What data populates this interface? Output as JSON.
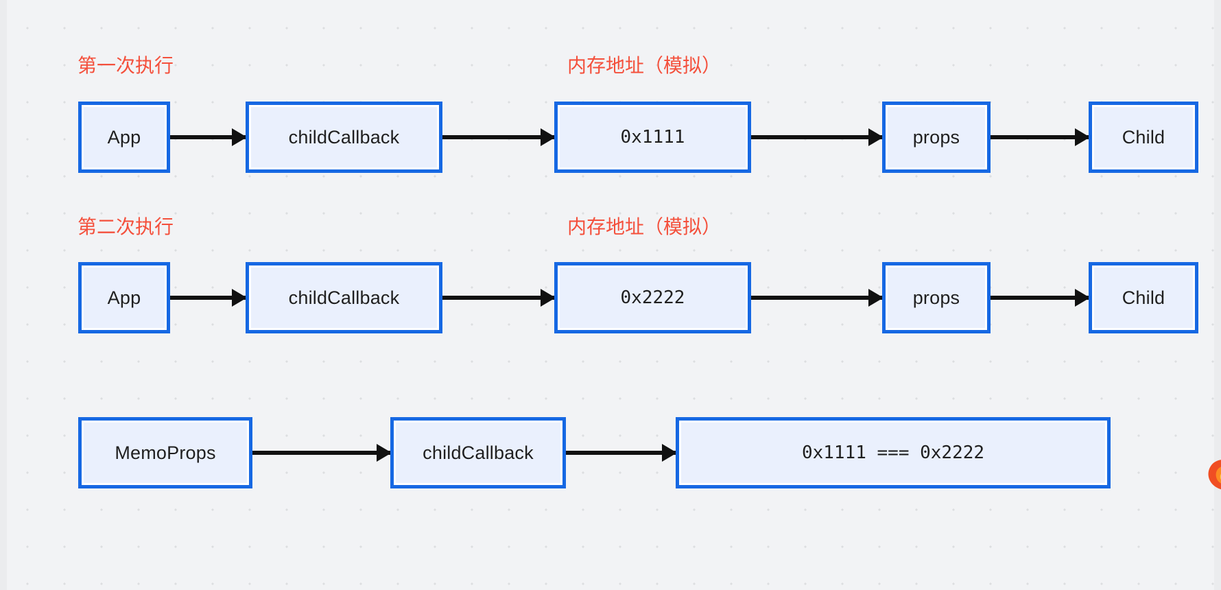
{
  "canvas": {
    "background_color": "#f2f3f5",
    "dot_color": "#dcdee0",
    "box_border_color": "#1668e3",
    "box_fill_color": "#eaf0fd",
    "arrow_color": "#111111",
    "annotation_color": "#f4503c"
  },
  "annotations": [
    {
      "id": "row1-label",
      "text": "第一次执行"
    },
    {
      "id": "row1-memory-label",
      "text": "内存地址（模拟）"
    },
    {
      "id": "row2-label",
      "text": "第二次执行"
    },
    {
      "id": "row2-memory-label",
      "text": "内存地址（模拟）"
    }
  ],
  "rows": [
    {
      "id": "row-first-execution",
      "label": "第一次执行",
      "memory_label": "内存地址（模拟）",
      "nodes": [
        {
          "id": "r1-app",
          "text": "App"
        },
        {
          "id": "r1-callback",
          "text": "childCallback"
        },
        {
          "id": "r1-address",
          "text": "0x1111"
        },
        {
          "id": "r1-props",
          "text": "props"
        },
        {
          "id": "r1-child",
          "text": "Child"
        }
      ]
    },
    {
      "id": "row-second-execution",
      "label": "第二次执行",
      "memory_label": "内存地址（模拟）",
      "nodes": [
        {
          "id": "r2-app",
          "text": "App"
        },
        {
          "id": "r2-callback",
          "text": "childCallback"
        },
        {
          "id": "r2-address",
          "text": "0x2222"
        },
        {
          "id": "r2-props",
          "text": "props"
        },
        {
          "id": "r2-child",
          "text": "Child"
        }
      ]
    },
    {
      "id": "row-comparison",
      "label": "",
      "memory_label": "",
      "nodes": [
        {
          "id": "r3-memoprops",
          "text": "MemoProps"
        },
        {
          "id": "r3-callback",
          "text": "childCallback"
        },
        {
          "id": "r3-compare",
          "text": "0x1111 === 0x2222"
        }
      ]
    }
  ],
  "corner": {
    "logo_name": "firefox-logo",
    "color_outer": "#f04e23",
    "color_inner": "#fd8c22"
  }
}
